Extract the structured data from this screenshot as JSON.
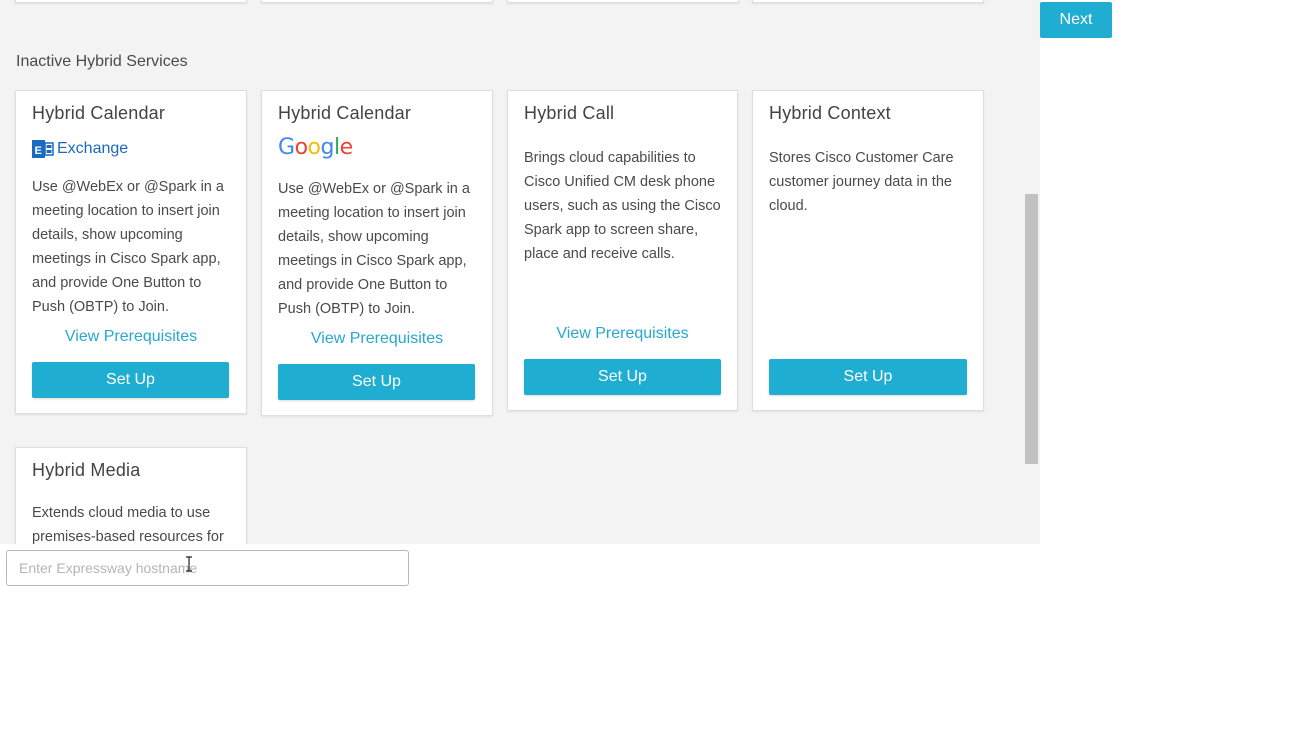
{
  "section": {
    "title": "Inactive Hybrid Services"
  },
  "next": {
    "label": "Next"
  },
  "expressway": {
    "placeholder": "Enter Expressway hostname"
  },
  "cards": [
    {
      "title": "Hybrid Calendar",
      "logo": {
        "icon": "exchange-logo-icon",
        "text": "Exchange",
        "color": "#1a6ac0"
      },
      "description": "Use @WebEx or @Spark in a meeting location to insert join details, show upcoming meetings in Cisco Spark app, and provide One Button to Push (OBTP) to Join.",
      "link": "View Prerequisites",
      "button": "Set Up"
    },
    {
      "title": "Hybrid Calendar",
      "logo": {
        "icon": "google-logo-icon",
        "letters": [
          "G",
          "o",
          "o",
          "g",
          "l",
          "e"
        ],
        "colors": [
          "#4285F4",
          "#EA4335",
          "#FBBC05",
          "#4285F4",
          "#34A853",
          "#EA4335"
        ]
      },
      "description": "Use @WebEx or @Spark in a meeting location to insert join details, show upcoming meetings in Cisco Spark app, and provide One Button to Push (OBTP) to Join.",
      "link": "View Prerequisites",
      "button": "Set Up"
    },
    {
      "title": "Hybrid Call",
      "description": "Brings cloud capabilities to Cisco Unified CM desk phone users, such as using the Cisco Spark app to screen share, place and receive calls.",
      "link": "View Prerequisites",
      "button": "Set Up"
    },
    {
      "title": "Hybrid Context",
      "description": "Stores Cisco Customer Care customer journey data in the cloud.",
      "button": "Set Up"
    },
    {
      "title": "Hybrid Media",
      "description": "Extends cloud media to use premises-based resources for"
    }
  ],
  "colors": {
    "accent": "#1fadd1",
    "link": "#26a8d1",
    "panel_bg": "#f3f3f3"
  }
}
